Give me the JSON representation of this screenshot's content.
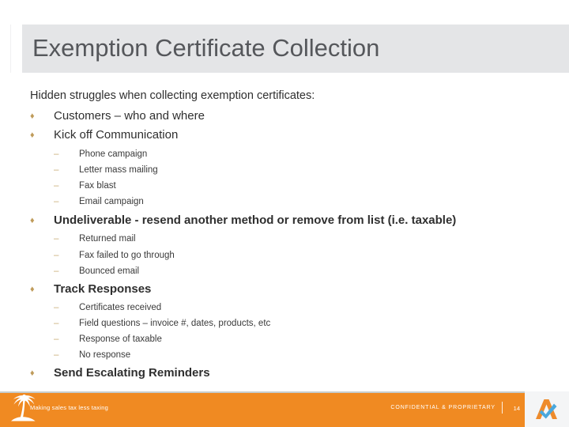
{
  "slide": {
    "title": "Exemption Certificate Collection",
    "lead": "Hidden struggles when collecting exemption certificates:",
    "bullet_marker": "♦",
    "sub_marker": "–",
    "blocks": [
      {
        "level1": "Customers – who and where",
        "bold": false,
        "children": []
      },
      {
        "level1": "Kick off Communication",
        "bold": false,
        "children": [
          "Phone campaign",
          "Letter mass mailing",
          "Fax blast",
          "Email campaign"
        ]
      },
      {
        "level1": "Undeliverable - resend another method or remove from list (i.e. taxable)",
        "bold": true,
        "children": [
          "Returned mail",
          "Fax failed to go through",
          "Bounced email"
        ]
      },
      {
        "level1": "Track Responses",
        "bold": true,
        "children": [
          "Certificates received",
          "Field questions – invoice #, dates, products, etc",
          "Response of taxable",
          "No response"
        ]
      },
      {
        "level1": "Send Escalating Reminders",
        "bold": true,
        "children": []
      }
    ]
  },
  "footer": {
    "tagline": "Making sales tax less taxing",
    "confidential": "CONFIDENTIAL & PROPRIETARY",
    "page_number": "14",
    "separator": "|",
    "palm_logo_name": "palm-tree-logo",
    "brand_logo_name": "avalara-a-logo"
  },
  "colors": {
    "footer_orange": "#f08a22",
    "title_band_gray": "#e4e5e7",
    "title_text": "#55575b",
    "body_text": "#2f2f2f",
    "bullet_gold": "#bf9b5a",
    "brand_blue": "#4aa8dd"
  }
}
